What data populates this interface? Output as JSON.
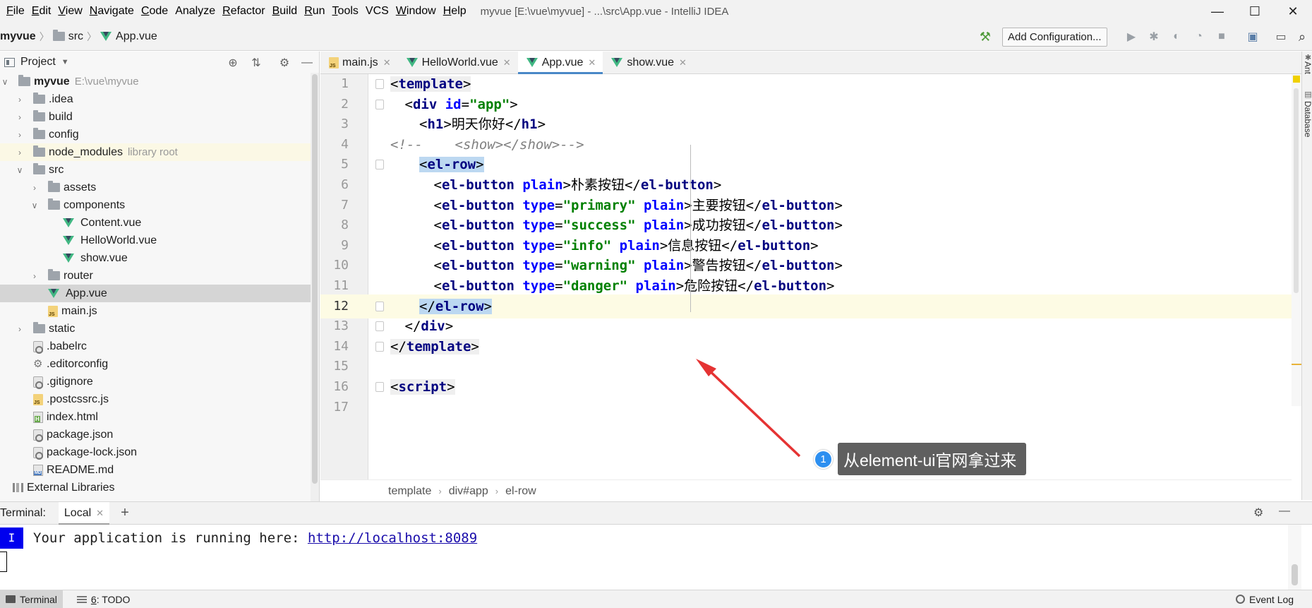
{
  "menu": {
    "items": [
      {
        "u": "F",
        "rest": "ile"
      },
      {
        "u": "E",
        "rest": "dit"
      },
      {
        "u": "V",
        "rest": "iew"
      },
      {
        "u": "N",
        "rest": "avigate"
      },
      {
        "u": "C",
        "rest": "ode"
      },
      {
        "u": "",
        "rest": "Analyze"
      },
      {
        "u": "R",
        "rest": "efactor"
      },
      {
        "u": "B",
        "rest": "uild"
      },
      {
        "u": "R",
        "rest": "un"
      },
      {
        "u": "T",
        "rest": "ools"
      },
      {
        "u": "",
        "rest": "VCS"
      },
      {
        "u": "W",
        "rest": "indow"
      },
      {
        "u": "H",
        "rest": "elp"
      }
    ],
    "window_title": "myvue [E:\\vue\\myvue] - ...\\src\\App.vue - IntelliJ IDEA"
  },
  "window_controls": {
    "minimize": "—",
    "maximize": "☐",
    "close": "✕"
  },
  "navbar": {
    "project": "myvue",
    "folder": "src",
    "file": "App.vue",
    "add_config": "Add Configuration..."
  },
  "project_panel": {
    "title": "Project",
    "tree": [
      {
        "indent": 0,
        "arrow": "v",
        "icon": "folder",
        "label": "myvue",
        "note": "E:\\vue\\myvue",
        "bold": true
      },
      {
        "indent": 1,
        "arrow": ">",
        "icon": "folder",
        "label": ".idea"
      },
      {
        "indent": 1,
        "arrow": ">",
        "icon": "folder",
        "label": "build"
      },
      {
        "indent": 1,
        "arrow": ">",
        "icon": "folder",
        "label": "config"
      },
      {
        "indent": 1,
        "arrow": ">",
        "icon": "folder",
        "label": "node_modules",
        "note": "library root",
        "lib": true
      },
      {
        "indent": 1,
        "arrow": "v",
        "icon": "folder",
        "label": "src"
      },
      {
        "indent": 2,
        "arrow": ">",
        "icon": "folder",
        "label": "assets"
      },
      {
        "indent": 2,
        "arrow": "v",
        "icon": "folder",
        "label": "components"
      },
      {
        "indent": 3,
        "arrow": "",
        "icon": "vue",
        "label": "Content.vue"
      },
      {
        "indent": 3,
        "arrow": "",
        "icon": "vue",
        "label": "HelloWorld.vue"
      },
      {
        "indent": 3,
        "arrow": "",
        "icon": "vue",
        "label": "show.vue"
      },
      {
        "indent": 2,
        "arrow": ">",
        "icon": "folder",
        "label": "router"
      },
      {
        "indent": 2,
        "arrow": "",
        "icon": "vue",
        "label": "App.vue",
        "selected": true
      },
      {
        "indent": 2,
        "arrow": "",
        "icon": "js",
        "label": "main.js"
      },
      {
        "indent": 1,
        "arrow": ">",
        "icon": "folder",
        "label": "static"
      },
      {
        "indent": 1,
        "arrow": "",
        "icon": "cfg",
        "label": ".babelrc"
      },
      {
        "indent": 1,
        "arrow": "",
        "icon": "gear",
        "label": ".editorconfig"
      },
      {
        "indent": 1,
        "arrow": "",
        "icon": "cfg",
        "label": ".gitignore"
      },
      {
        "indent": 1,
        "arrow": "",
        "icon": "js",
        "label": ".postcssrc.js"
      },
      {
        "indent": 1,
        "arrow": "",
        "icon": "html",
        "label": "index.html"
      },
      {
        "indent": 1,
        "arrow": "",
        "icon": "cfg",
        "label": "package.json"
      },
      {
        "indent": 1,
        "arrow": "",
        "icon": "cfg",
        "label": "package-lock.json"
      },
      {
        "indent": 1,
        "arrow": "",
        "icon": "md",
        "label": "README.md"
      },
      {
        "indent": 0,
        "arrow": "",
        "icon": "extlib",
        "label": "External Libraries",
        "wide": true
      }
    ]
  },
  "tabs": [
    {
      "icon": "js",
      "label": "main.js",
      "active": false
    },
    {
      "icon": "vue",
      "label": "HelloWorld.vue",
      "active": false
    },
    {
      "icon": "vue",
      "label": "App.vue",
      "active": true
    },
    {
      "icon": "vue",
      "label": "show.vue",
      "active": false
    }
  ],
  "editor": {
    "current_line": 12,
    "lines": [
      {
        "n": "1",
        "indent": 0,
        "fold": true,
        "tokens": [
          [
            "tagbg",
            "<"
          ],
          [
            "tag tagbg",
            "template"
          ],
          [
            "tagbg",
            ">"
          ]
        ]
      },
      {
        "n": "2",
        "indent": 1,
        "fold": true,
        "tokens": [
          [
            "",
            "<"
          ],
          [
            "tag",
            "div "
          ],
          [
            "attr",
            "id"
          ],
          [
            "",
            "="
          ],
          [
            "val",
            "\"app\""
          ],
          [
            "",
            ">"
          ]
        ]
      },
      {
        "n": "3",
        "indent": 2,
        "fold": false,
        "tokens": [
          [
            "",
            "<"
          ],
          [
            "tag",
            "h1"
          ],
          [
            "",
            ">明天你好</"
          ],
          [
            "tag",
            "h1"
          ],
          [
            "",
            ">"
          ]
        ]
      },
      {
        "n": "4",
        "indent": 0,
        "fold": false,
        "tokens": [
          [
            "cmt",
            "<!--    <show></show>-->"
          ]
        ]
      },
      {
        "n": "5",
        "indent": 2,
        "fold": true,
        "tokens": [
          [
            "hl",
            "<"
          ],
          [
            "tag hl",
            "el-row"
          ],
          [
            "hl",
            ">"
          ]
        ]
      },
      {
        "n": "6",
        "indent": 3,
        "fold": false,
        "tokens": [
          [
            "",
            "<"
          ],
          [
            "tag",
            "el-button "
          ],
          [
            "attr",
            "plain"
          ],
          [
            "",
            ">朴素按钮</"
          ],
          [
            "tag",
            "el-button"
          ],
          [
            "",
            ">"
          ]
        ]
      },
      {
        "n": "7",
        "indent": 3,
        "fold": false,
        "tokens": [
          [
            "",
            "<"
          ],
          [
            "tag",
            "el-button "
          ],
          [
            "attr",
            "type"
          ],
          [
            "",
            "="
          ],
          [
            "val",
            "\"primary\""
          ],
          [
            "",
            " "
          ],
          [
            "attr",
            "plain"
          ],
          [
            "",
            ">主要按钮</"
          ],
          [
            "tag",
            "el-button"
          ],
          [
            "",
            ">"
          ]
        ]
      },
      {
        "n": "8",
        "indent": 3,
        "fold": false,
        "tokens": [
          [
            "",
            "<"
          ],
          [
            "tag",
            "el-button "
          ],
          [
            "attr",
            "type"
          ],
          [
            "",
            "="
          ],
          [
            "val",
            "\"success\""
          ],
          [
            "",
            " "
          ],
          [
            "attr",
            "plain"
          ],
          [
            "",
            ">成功按钮</"
          ],
          [
            "tag",
            "el-button"
          ],
          [
            "",
            ">"
          ]
        ]
      },
      {
        "n": "9",
        "indent": 3,
        "fold": false,
        "tokens": [
          [
            "",
            "<"
          ],
          [
            "tag",
            "el-button "
          ],
          [
            "attr",
            "type"
          ],
          [
            "",
            "="
          ],
          [
            "val",
            "\"info\""
          ],
          [
            "",
            " "
          ],
          [
            "attr",
            "plain"
          ],
          [
            "",
            ">信息按钮</"
          ],
          [
            "tag",
            "el-button"
          ],
          [
            "",
            ">"
          ]
        ]
      },
      {
        "n": "10",
        "indent": 3,
        "fold": false,
        "tokens": [
          [
            "",
            "<"
          ],
          [
            "tag",
            "el-button "
          ],
          [
            "attr",
            "type"
          ],
          [
            "",
            "="
          ],
          [
            "val",
            "\"warning\""
          ],
          [
            "",
            " "
          ],
          [
            "attr",
            "plain"
          ],
          [
            "",
            ">警告按钮</"
          ],
          [
            "tag",
            "el-button"
          ],
          [
            "",
            ">"
          ]
        ]
      },
      {
        "n": "11",
        "indent": 3,
        "fold": false,
        "tokens": [
          [
            "",
            "<"
          ],
          [
            "tag",
            "el-button "
          ],
          [
            "attr",
            "type"
          ],
          [
            "",
            "="
          ],
          [
            "val",
            "\"danger\""
          ],
          [
            "",
            " "
          ],
          [
            "attr",
            "plain"
          ],
          [
            "",
            ">危险按钮</"
          ],
          [
            "tag",
            "el-button"
          ],
          [
            "",
            ">"
          ]
        ]
      },
      {
        "n": "12",
        "indent": 2,
        "fold": true,
        "tokens": [
          [
            "hl",
            "</"
          ],
          [
            "tag hl",
            "el-row"
          ],
          [
            "hl",
            ">"
          ]
        ]
      },
      {
        "n": "13",
        "indent": 1,
        "fold": true,
        "tokens": [
          [
            "",
            "</"
          ],
          [
            "tag",
            "div"
          ],
          [
            "",
            ">"
          ]
        ]
      },
      {
        "n": "14",
        "indent": 0,
        "fold": true,
        "tokens": [
          [
            "tagbg",
            "</"
          ],
          [
            "tag tagbg",
            "template"
          ],
          [
            "tagbg",
            ">"
          ]
        ]
      },
      {
        "n": "15",
        "indent": 0,
        "fold": false,
        "tokens": []
      },
      {
        "n": "16",
        "indent": 0,
        "fold": true,
        "tokens": [
          [
            "tagbg",
            "<"
          ],
          [
            "tag tagbg",
            "script"
          ],
          [
            "tagbg",
            ">"
          ]
        ]
      },
      {
        "n": "17",
        "indent": 0,
        "fold": false,
        "tokens": []
      }
    ]
  },
  "breadcrumbs": [
    "template",
    "div#app",
    "el-row"
  ],
  "right_strip": {
    "ant": "Ant",
    "database": "Database"
  },
  "terminal": {
    "label": "Terminal:",
    "tab": "Local",
    "add": "+",
    "cursor_char": "I",
    "line_text": "Your application is running here: ",
    "link": "http://localhost:8089"
  },
  "statusbar": {
    "terminal": "Terminal",
    "todo_key": "6",
    "todo_rest": ": TODO",
    "event_log": "Event Log"
  },
  "annotation": {
    "number": "1",
    "text": "从element-ui官网拿过来"
  },
  "colors": {
    "accent": "#4a88c7",
    "vue_green": "#41b883",
    "arrow_red": "#e53333",
    "annotation_bg": "#5f5f5f"
  }
}
